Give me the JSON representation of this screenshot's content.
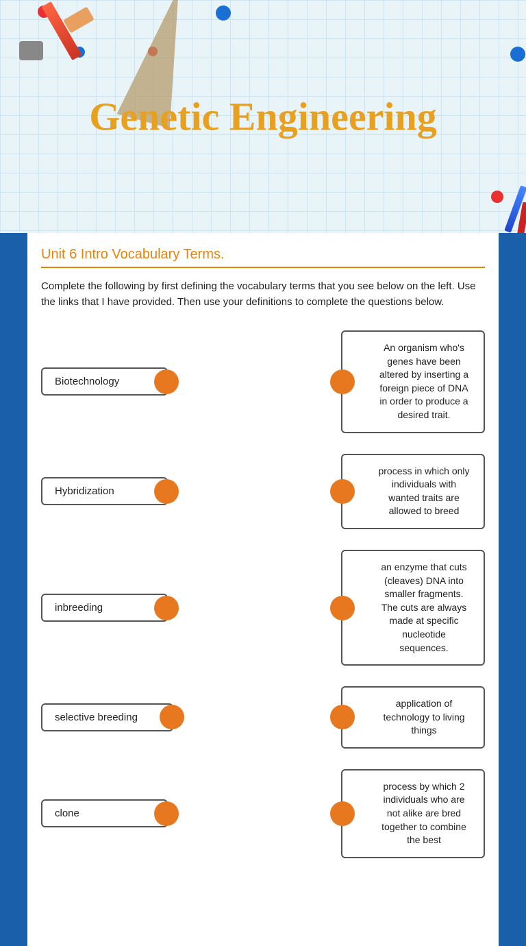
{
  "header": {
    "title": "Genetic Engineering"
  },
  "section": {
    "title": "Unit 6 Intro Vocabulary Terms.",
    "instructions": "Complete the following by first defining the vocabulary terms that you see below on the left. Use the links that I have provided. Then use your definitions to complete the questions below."
  },
  "terms": [
    {
      "id": "biotechnology",
      "label": "Biotechnology"
    },
    {
      "id": "hybridization",
      "label": "Hybridization"
    },
    {
      "id": "inbreeding",
      "label": "inbreeding"
    },
    {
      "id": "selective-breeding",
      "label": "selective breeding"
    },
    {
      "id": "clone",
      "label": "clone"
    }
  ],
  "definitions": [
    {
      "id": "def-gmo",
      "text": "An organism who's genes have been altered by inserting a foreign piece of DNA in order to produce a desired trait."
    },
    {
      "id": "def-selective",
      "text": "process in which only individuals with wanted traits are allowed to breed"
    },
    {
      "id": "def-enzyme",
      "text": "an enzyme that cuts (cleaves) DNA into smaller fragments. The cuts are always made at specific nucleotide sequences."
    },
    {
      "id": "def-biotech",
      "text": "application of technology to living things"
    },
    {
      "id": "def-hybrid",
      "text": "process by which 2 individuals who are not alike are bred together to combine the best"
    }
  ]
}
